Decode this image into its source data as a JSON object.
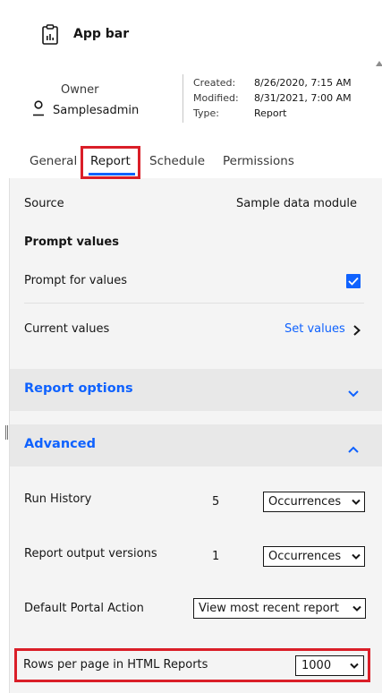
{
  "header": {
    "app_title": "App bar",
    "owner_label": "Owner",
    "owner_name": "Samplesadmin",
    "meta": [
      {
        "key": "Created:",
        "value": "8/26/2020, 7:15 AM"
      },
      {
        "key": "Modified:",
        "value": "8/31/2021, 7:00 AM"
      },
      {
        "key": "Type:",
        "value": "Report"
      }
    ]
  },
  "tabs": [
    "General",
    "Report",
    "Schedule",
    "Permissions"
  ],
  "active_tab": "Report",
  "report": {
    "source_label": "Source",
    "source_value": "Sample data module",
    "prompt_heading": "Prompt values",
    "prompt_for_values_label": "Prompt for values",
    "prompt_for_values_checked": true,
    "current_values_label": "Current values",
    "set_values_link": "Set values",
    "report_options_title": "Report options",
    "advanced_title": "Advanced",
    "run_history_label": "Run History",
    "run_history_count": "5",
    "run_history_unit": "Occurrences",
    "output_versions_label": "Report output versions",
    "output_versions_count": "1",
    "output_versions_unit": "Occurrences",
    "portal_action_label": "Default Portal Action",
    "portal_action_value": "View most recent report",
    "rows_per_page_label": "Rows per page in HTML Reports",
    "rows_per_page_value": "1000"
  },
  "colors": {
    "accent": "#0f62fe",
    "highlight": "#da1e28",
    "content_bg": "#f4f4f4",
    "section_bg": "#e8e8e8"
  },
  "icons": {
    "app": "report-icon",
    "owner": "user-icon",
    "checkbox": "checkmark-icon",
    "link": "chevron-right-icon",
    "section_collapsed": "chevron-down-icon",
    "section_expanded": "chevron-up-icon",
    "select": "chevron-down-icon"
  }
}
